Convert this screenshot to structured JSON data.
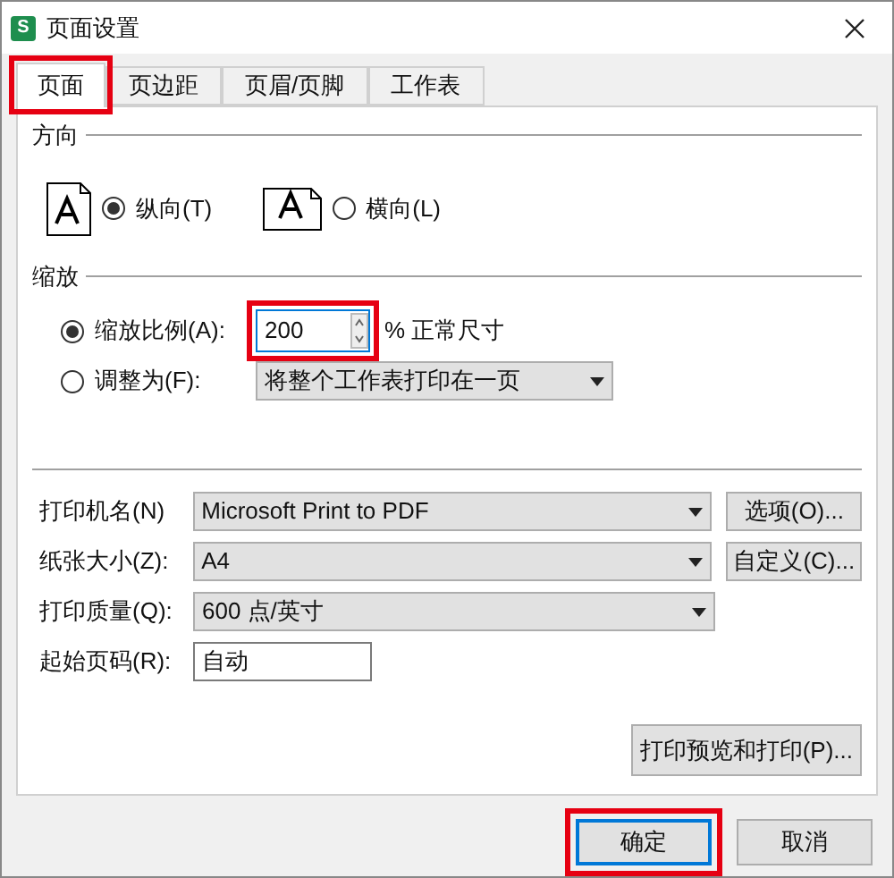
{
  "window": {
    "logo": "S",
    "title": "页面设置"
  },
  "tabs": [
    {
      "label": "页面",
      "selected": true,
      "highlighted": true
    },
    {
      "label": "页边距",
      "selected": false,
      "highlighted": false
    },
    {
      "label": "页眉/页脚",
      "selected": false,
      "highlighted": false
    },
    {
      "label": "工作表",
      "selected": false,
      "highlighted": false
    }
  ],
  "orientation": {
    "title": "方向",
    "options": [
      {
        "label": "纵向(T)",
        "selected": true,
        "kind": "portrait"
      },
      {
        "label": "横向(L)",
        "selected": false,
        "kind": "landscape"
      }
    ]
  },
  "scaling": {
    "title": "缩放",
    "scale": {
      "label": "缩放比例(A):",
      "selected": true,
      "value": "200",
      "unit": "% 正常尺寸",
      "highlighted": true
    },
    "fit": {
      "label": "调整为(F):",
      "selected": false,
      "value": "将整个工作表打印在一页"
    }
  },
  "print_settings": [
    {
      "label": "打印机名(N)",
      "value": "Microsoft Print to PDF",
      "kind": "dropdown",
      "button": "选项(O)..."
    },
    {
      "label": "纸张大小(Z):",
      "value": "A4",
      "kind": "dropdown",
      "button": "自定义(C)..."
    },
    {
      "label": "打印质量(Q):",
      "value": "600 点/英寸",
      "kind": "dropdown"
    },
    {
      "label": "起始页码(R):",
      "value": "自动",
      "kind": "text"
    }
  ],
  "preview_button": "打印预览和打印(P)...",
  "buttons": [
    {
      "label": "确定",
      "default": true,
      "highlighted": true
    },
    {
      "label": "取消",
      "default": false,
      "highlighted": false
    }
  ]
}
